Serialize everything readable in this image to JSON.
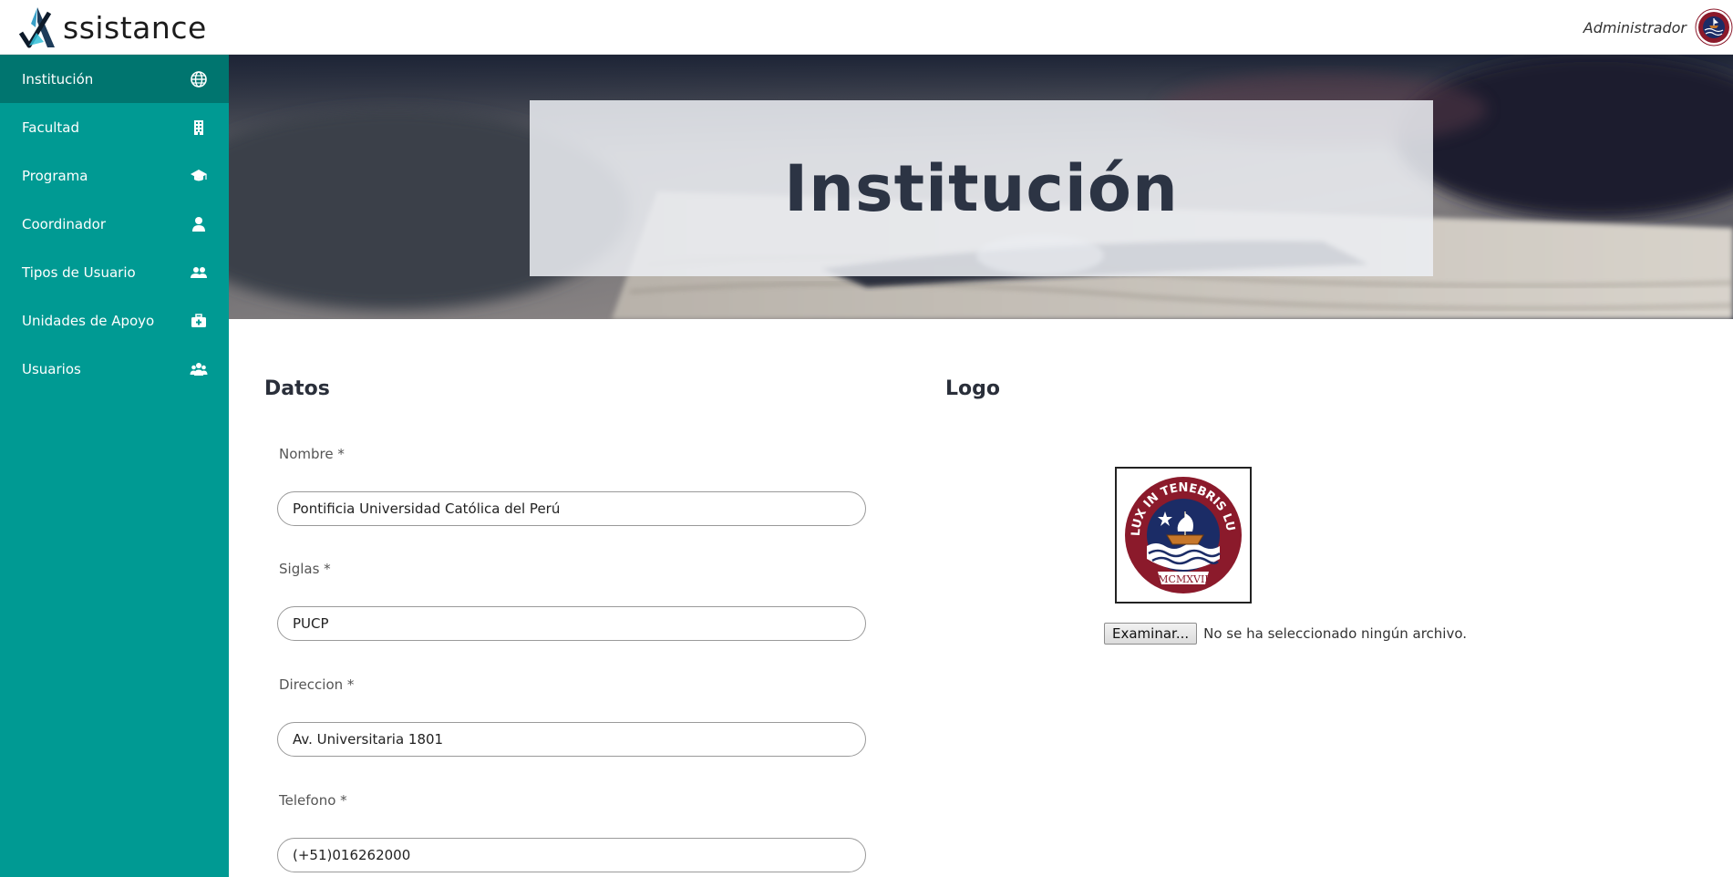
{
  "app": {
    "brand_text": "ssistance",
    "user_name": "Administrador",
    "accent_color": "#009a93",
    "accent_active_color": "#00756f"
  },
  "sidebar": {
    "items": [
      {
        "label": "Institución",
        "icon": "globe-icon",
        "active": true
      },
      {
        "label": "Facultad",
        "icon": "building-icon",
        "active": false
      },
      {
        "label": "Programa",
        "icon": "graduation-cap-icon",
        "active": false
      },
      {
        "label": "Coordinador",
        "icon": "person-icon",
        "active": false
      },
      {
        "label": "Tipos de Usuario",
        "icon": "people-icon",
        "active": false
      },
      {
        "label": "Unidades de Apoyo",
        "icon": "medical-kit-icon",
        "active": false
      },
      {
        "label": "Usuarios",
        "icon": "user-group-icon",
        "active": false
      }
    ]
  },
  "banner": {
    "title": "Institución"
  },
  "datos": {
    "title": "Datos",
    "fields": [
      {
        "label": "Nombre *",
        "value": "Pontificia Universidad Católica del Perú"
      },
      {
        "label": "Siglas *",
        "value": "PUCP"
      },
      {
        "label": "Direccion *",
        "value": "Av. Universitaria 1801"
      },
      {
        "label": "Telefono *",
        "value": "(+51)016262000"
      }
    ]
  },
  "logo": {
    "title": "Logo",
    "seal_text": "ET LUX IN TENEBRIS LUCET",
    "seal_year": "MCMXVII",
    "file_button": "Examinar...",
    "file_status": "No se ha seleccionado ningún archivo."
  }
}
